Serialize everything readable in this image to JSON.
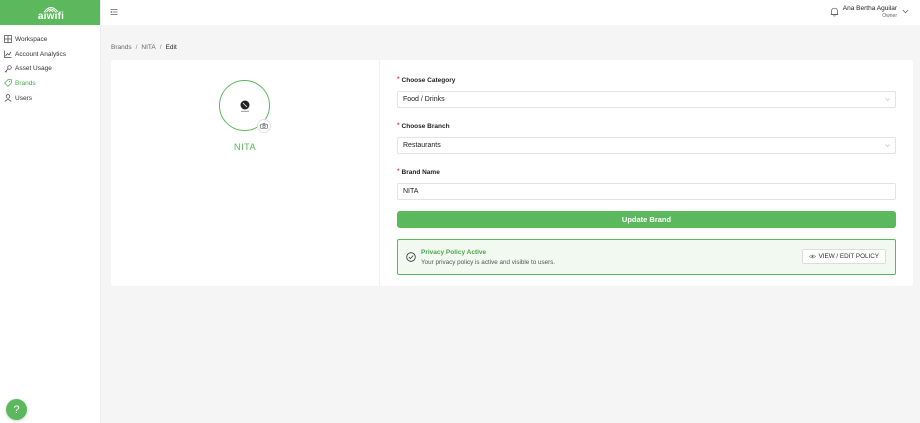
{
  "app": {
    "logo_text": "aiwifi",
    "brand_color": "#5cb85c"
  },
  "sidebar": {
    "items": [
      {
        "label": "Workspace",
        "icon": "grid-icon",
        "active": false
      },
      {
        "label": "Account Analytics",
        "icon": "bar-chart-icon",
        "active": false
      },
      {
        "label": "Asset Usage",
        "icon": "key-icon",
        "active": false
      },
      {
        "label": "Brands",
        "icon": "tag-icon",
        "active": true
      },
      {
        "label": "Users",
        "icon": "user-icon",
        "active": false
      }
    ],
    "help_label": "?"
  },
  "header": {
    "user_name": "Ana Bertha Aguilar",
    "user_role": "Owner"
  },
  "breadcrumb": {
    "items": [
      "Brands",
      "NITA",
      "Edit"
    ],
    "separator": "/"
  },
  "brand": {
    "name": "NITA"
  },
  "form": {
    "category_label": "Choose Category",
    "category_value": "Food / Drinks",
    "branch_label": "Choose Branch",
    "branch_value": "Restaurants",
    "name_label": "Brand Name",
    "name_value": "NITA",
    "required_mark": "*",
    "submit_label": "Update Brand"
  },
  "policy": {
    "title": "Privacy Policy Active",
    "description": "Your privacy policy is active and visible to users.",
    "button_label": "VIEW / EDIT POLICY"
  }
}
